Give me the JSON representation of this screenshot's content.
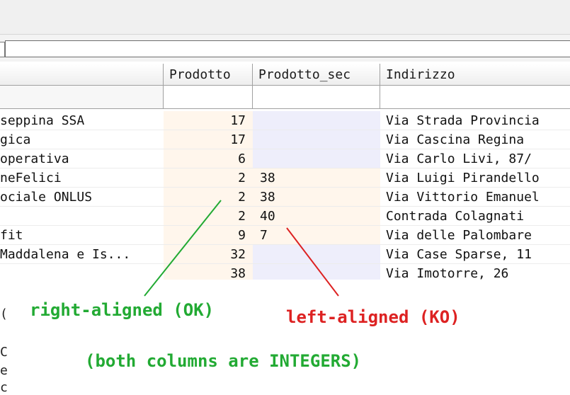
{
  "grid": {
    "headers": [
      "Prodotto",
      "Prodotto_sec",
      "Indirizzo"
    ],
    "rows": [
      {
        "name": "seppina SSA",
        "prodotto": "17",
        "prodotto_sec": "",
        "sec_bg": "blue",
        "indirizzo": "Via Strada Provincia"
      },
      {
        "name": "gica",
        "prodotto": "17",
        "prodotto_sec": "",
        "sec_bg": "blue",
        "indirizzo": "Via Cascina Regina"
      },
      {
        "name": "operativa",
        "prodotto": "6",
        "prodotto_sec": "",
        "sec_bg": "blue",
        "indirizzo": "Via Carlo Livi, 87/"
      },
      {
        "name": "neFelici",
        "prodotto": "2",
        "prodotto_sec": "38",
        "sec_bg": "cream",
        "indirizzo": "Via Luigi Pirandello"
      },
      {
        "name": "ociale ONLUS",
        "prodotto": "2",
        "prodotto_sec": "38",
        "sec_bg": "cream",
        "indirizzo": "Via Vittorio Emanuel"
      },
      {
        "name": "",
        "prodotto": "2",
        "prodotto_sec": "40",
        "sec_bg": "cream",
        "indirizzo": "Contrada Colagnati"
      },
      {
        "name": "fit",
        "prodotto": "9",
        "prodotto_sec": "7",
        "sec_bg": "cream",
        "indirizzo": "Via delle Palombare"
      },
      {
        "name": "Maddalena e Is...",
        "prodotto": "32",
        "prodotto_sec": "",
        "sec_bg": "blue",
        "indirizzo": "Via Case Sparse, 11"
      },
      {
        "name": "",
        "prodotto": "38",
        "prodotto_sec": "",
        "sec_bg": "blue",
        "indirizzo": "Via Imotorre, 26"
      }
    ]
  },
  "annotations": {
    "right_aligned": "right-aligned (OK)",
    "left_aligned": "left-aligned (KO)",
    "note": "(both columns are INTEGERS)"
  },
  "colors": {
    "green": "#22aa33",
    "red": "#dd2222",
    "prodotto_bg": "#fff6ec",
    "sec_blue_bg": "#eeeefb"
  }
}
